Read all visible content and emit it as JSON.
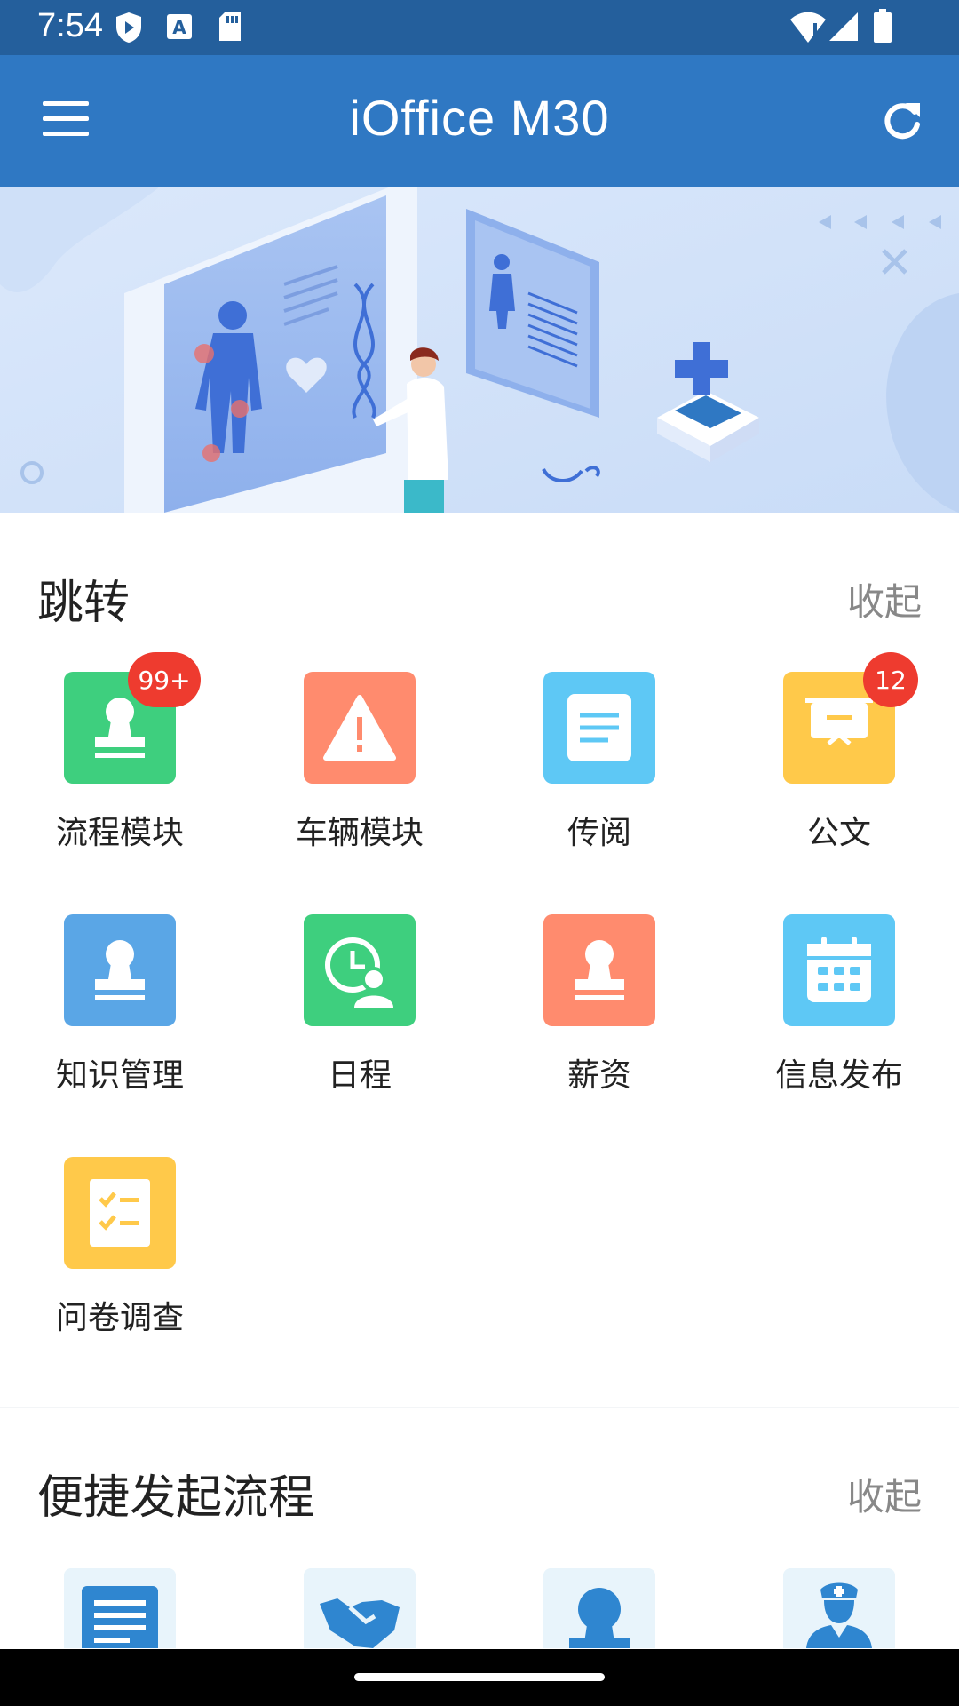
{
  "status_bar": {
    "time": "7:54",
    "icons_left": [
      "shield-icon",
      "font-a-icon",
      "sd-card-icon"
    ],
    "icons_right": [
      "wifi-icon",
      "signal-icon",
      "battery-icon"
    ]
  },
  "app_bar": {
    "title": "iOffice M30",
    "menu_icon": "hamburger-menu-icon",
    "refresh_icon": "refresh-icon"
  },
  "banner": {
    "description_icon": "medical-illustration"
  },
  "jump_section": {
    "title": "跳转",
    "collapse_label": "收起",
    "items": [
      {
        "label": "流程模块",
        "icon": "stamp-icon",
        "color": "#3ecf7e",
        "badge": "99+"
      },
      {
        "label": "车辆模块",
        "icon": "warning-triangle-icon",
        "color": "#ff8b6e",
        "badge": ""
      },
      {
        "label": "传阅",
        "icon": "document-icon",
        "color": "#5ec8f5",
        "badge": ""
      },
      {
        "label": "公文",
        "icon": "presentation-board-icon",
        "color": "#ffc94a",
        "badge": "12"
      },
      {
        "label": "知识管理",
        "icon": "stamp-icon",
        "color": "#5aa6e6",
        "badge": ""
      },
      {
        "label": "日程",
        "icon": "clock-user-icon",
        "color": "#3ecf7e",
        "badge": ""
      },
      {
        "label": "薪资",
        "icon": "stamp-icon",
        "color": "#ff8b6e",
        "badge": ""
      },
      {
        "label": "信息发布",
        "icon": "calendar-icon",
        "color": "#5ec8f5",
        "badge": ""
      },
      {
        "label": "问卷调查",
        "icon": "checklist-icon",
        "color": "#ffc94a",
        "badge": ""
      }
    ]
  },
  "quick_section": {
    "title": "便捷发起流程",
    "collapse_label": "收起",
    "items": [
      {
        "icon": "document-lines-icon",
        "color": "#2f86d0"
      },
      {
        "icon": "handshake-icon",
        "color": "#2f86d0"
      },
      {
        "icon": "person-icon",
        "color": "#2f86d0"
      },
      {
        "icon": "nurse-icon",
        "color": "#2f86d0"
      }
    ]
  }
}
